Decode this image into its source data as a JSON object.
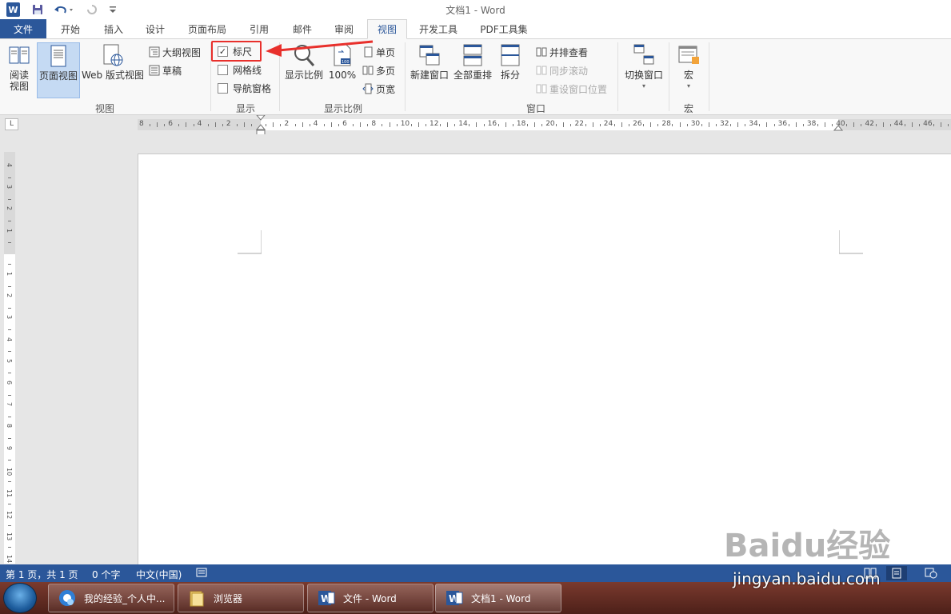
{
  "window": {
    "title": "文档1 - Word"
  },
  "tabs": {
    "file": "文件",
    "items": [
      "开始",
      "插入",
      "设计",
      "页面布局",
      "引用",
      "邮件",
      "审阅",
      "视图",
      "开发工具",
      "PDF工具集"
    ],
    "active": "视图"
  },
  "ribbon": {
    "views": {
      "label": "视图",
      "read": "阅读\n视图",
      "print_layout": "页面视图",
      "web_layout": "Web 版式视图",
      "outline": "大纲视图",
      "draft": "草稿"
    },
    "show": {
      "label": "显示",
      "ruler": "标尺",
      "ruler_checked": true,
      "gridlines": "网格线",
      "nav_pane": "导航窗格"
    },
    "zoom": {
      "label": "显示比例",
      "zoom": "显示比例",
      "hundred": "100%",
      "one_page": "单页",
      "multiple_pages": "多页",
      "page_width": "页宽"
    },
    "window": {
      "label": "窗口",
      "new_window": "新建窗口",
      "arrange_all": "全部重排",
      "split": "拆分",
      "side_by_side": "并排查看",
      "sync_scroll": "同步滚动",
      "reset_position": "重设窗口位置",
      "switch_windows": "切换窗口"
    },
    "macros": {
      "label": "宏",
      "macros": "宏"
    }
  },
  "ruler": {
    "corner": "L",
    "h_labels": [
      "8",
      "6",
      "4",
      "2",
      "",
      "2",
      "4",
      "6",
      "8",
      "10",
      "12",
      "14",
      "16",
      "18",
      "20",
      "22",
      "24",
      "26",
      "28",
      "30",
      "32",
      "34",
      "36",
      "38",
      "40",
      "42",
      "44",
      "46"
    ],
    "v_labels": [
      "4",
      "3",
      "2",
      "1",
      "",
      "1",
      "2",
      "3",
      "4",
      "5",
      "6",
      "7",
      "8",
      "9",
      "10",
      "11",
      "12",
      "13",
      "14"
    ]
  },
  "status": {
    "page": "第 1 页，共 1 页",
    "words": "0 个字",
    "language": "中文(中国)"
  },
  "taskbar": {
    "items": [
      "我的经验_个人中...",
      "浏览器",
      "文件 - Word",
      "文档1 - Word"
    ]
  },
  "watermark": {
    "text": "Baidu经验",
    "url": "jingyan.baidu.com"
  },
  "colors": {
    "word_blue": "#2b579a",
    "highlight_red": "#e8302c",
    "taskbar": "#5e2a21"
  }
}
